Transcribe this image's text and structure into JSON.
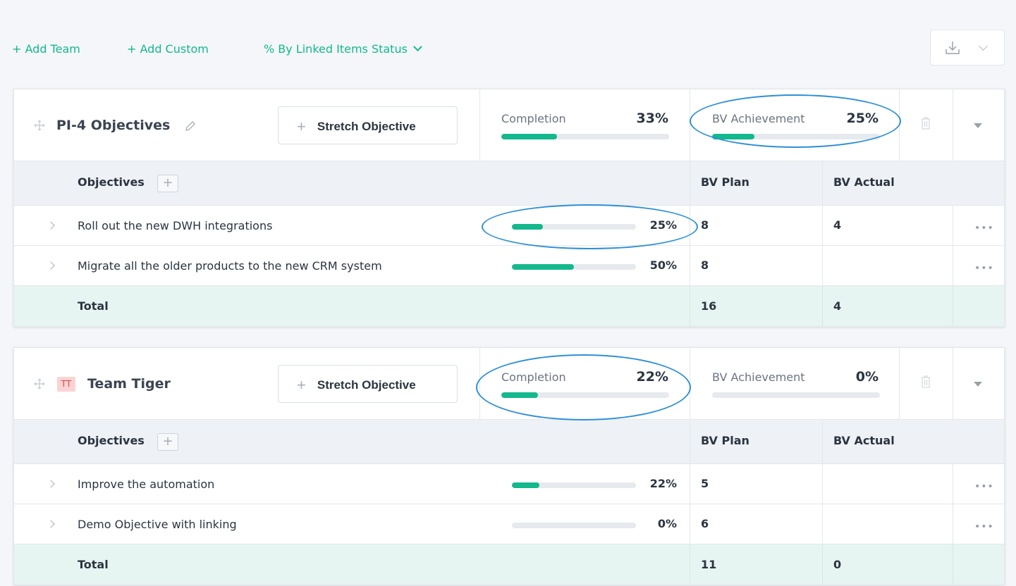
{
  "toolbar": {
    "add_team": "+ Add Team",
    "add_custom": "+ Add Custom",
    "status_dropdown": "% By Linked Items Status",
    "download_icon": "download-icon"
  },
  "labels": {
    "stretch_objective": "Stretch Objective",
    "completion": "Completion",
    "bv_achievement": "BV Achievement",
    "objectives": "Objectives",
    "bv_plan": "BV Plan",
    "bv_actual": "BV Actual",
    "total": "Total",
    "more": "•••"
  },
  "cards": [
    {
      "title": "PI-4 Objectives",
      "badge": "",
      "completion": "33%",
      "completion_fraction": 0.33,
      "bv_achievement": "25%",
      "bv_achievement_fraction": 0.25,
      "objectives": [
        {
          "name": "Roll out the new DWH integrations",
          "progress": "25%",
          "progress_fraction": 0.25,
          "bv_plan": "8",
          "bv_actual": "4"
        },
        {
          "name": "Migrate all the older products to the new CRM system",
          "progress": "50%",
          "progress_fraction": 0.5,
          "bv_plan": "8",
          "bv_actual": ""
        }
      ],
      "total_bv_plan": "16",
      "total_bv_actual": "4"
    },
    {
      "title": "Team Tiger",
      "badge": "TT",
      "completion": "22%",
      "completion_fraction": 0.22,
      "bv_achievement": "0%",
      "bv_achievement_fraction": 0,
      "objectives": [
        {
          "name": "Improve the automation",
          "progress": "22%",
          "progress_fraction": 0.22,
          "bv_plan": "5",
          "bv_actual": ""
        },
        {
          "name": "Demo Objective with linking",
          "progress": "0%",
          "progress_fraction": 0,
          "bv_plan": "6",
          "bv_actual": ""
        }
      ],
      "total_bv_plan": "11",
      "total_bv_actual": "0"
    }
  ],
  "colors": {
    "accent": "#14b88d",
    "annotation": "#2e8fd6",
    "total_row": "#e6f5f2"
  }
}
